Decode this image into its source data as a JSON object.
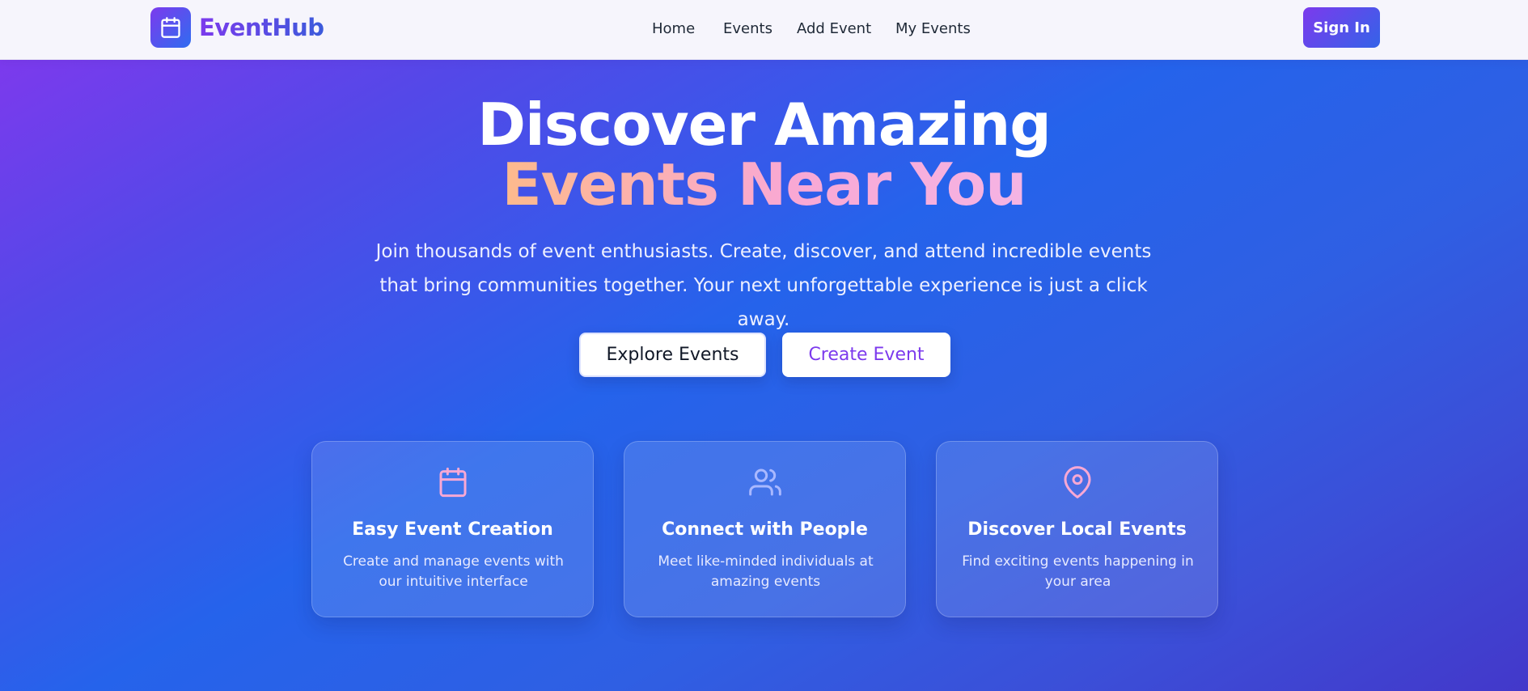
{
  "brand": {
    "name": "EventHub",
    "icon": "calendar-icon"
  },
  "nav": {
    "items": [
      {
        "label": "Home"
      },
      {
        "label": "Events"
      },
      {
        "label": "Add Event"
      },
      {
        "label": "My Events"
      }
    ],
    "signin_label": "Sign In"
  },
  "hero": {
    "title_line1": "Discover Amazing",
    "title_line2": "Events Near You",
    "subtitle": "Join thousands of event enthusiasts. Create, discover, and attend incredible events that bring communities together. Your next unforgettable experience is just a click away.",
    "explore_label": "Explore Events",
    "create_label": "Create Event"
  },
  "features": [
    {
      "icon": "calendar-icon",
      "title": "Easy Event Creation",
      "desc": "Create and manage events with our intuitive interface"
    },
    {
      "icon": "users-icon",
      "title": "Connect with People",
      "desc": "Meet like-minded individuals at amazing events"
    },
    {
      "icon": "map-pin-icon",
      "title": "Discover Local Events",
      "desc": "Find exciting events happening in your area"
    }
  ],
  "colors": {
    "accent_purple": "#7c3aed",
    "accent_blue": "#2563eb",
    "icon_pink": "#f9a8d4",
    "icon_lavender": "#a9b8ff"
  }
}
